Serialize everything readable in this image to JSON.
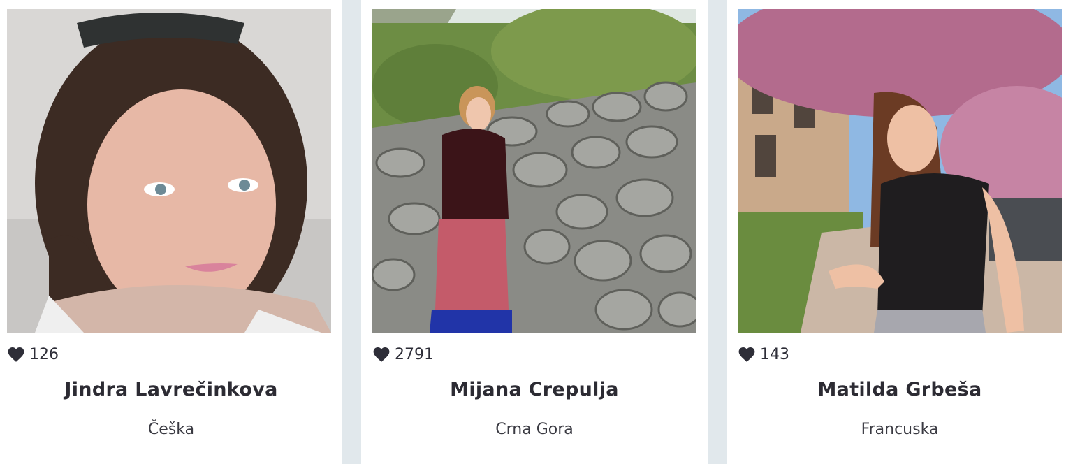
{
  "cards": [
    {
      "likes": "126",
      "name": "Jindra Lavrečinkova",
      "country": "Češka"
    },
    {
      "likes": "2791",
      "name": "Mijana Crepulja",
      "country": "Crna Gora"
    },
    {
      "likes": "143",
      "name": "Matilda Grbeša",
      "country": "Francuska"
    }
  ],
  "icons": {
    "likes": "heart-icon"
  },
  "colors": {
    "background": "#e1e8ec",
    "card": "#ffffff",
    "text": "#2c2b33"
  }
}
